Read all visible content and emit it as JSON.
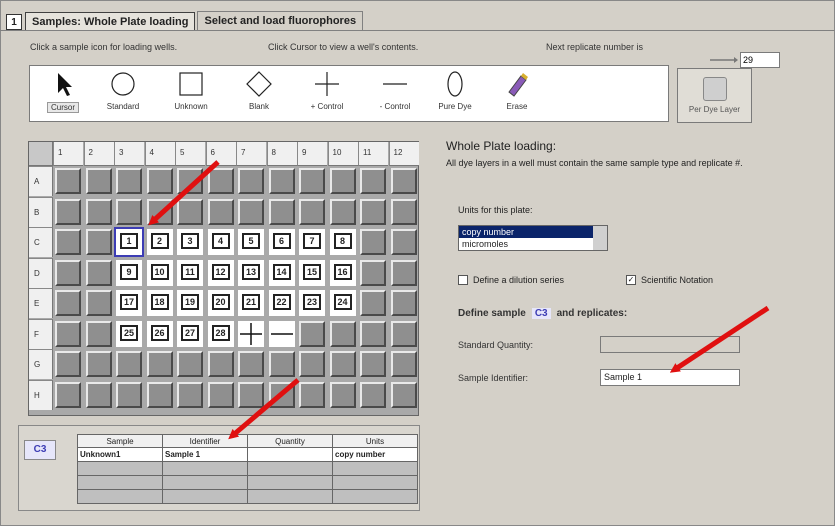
{
  "tabs": {
    "number": "1",
    "items": [
      {
        "label": "Samples: Whole Plate loading",
        "active": true
      },
      {
        "label": "Select and load fluorophores",
        "active": false
      }
    ]
  },
  "hints": {
    "left": "Click a sample icon for loading wells.",
    "mid": "Click Cursor to view a well's contents.",
    "replicate_label": "Next replicate number is",
    "replicate_value": "29"
  },
  "tools": [
    {
      "label": "Cursor",
      "icon": "cursor-icon"
    },
    {
      "label": "Standard",
      "icon": "circle-icon"
    },
    {
      "label": "Unknown",
      "icon": "square-icon"
    },
    {
      "label": "Blank",
      "icon": "diamond-icon"
    },
    {
      "label": "+ Control",
      "icon": "plus-icon"
    },
    {
      "label": "- Control",
      "icon": "minus-icon"
    },
    {
      "label": "Pure Dye",
      "icon": "oval-icon"
    },
    {
      "label": "Erase",
      "icon": "eraser-icon"
    }
  ],
  "per_dye_layer": {
    "label": "Per Dye Layer"
  },
  "plate": {
    "columns": [
      "1",
      "2",
      "3",
      "4",
      "5",
      "6",
      "7",
      "8",
      "9",
      "10",
      "11",
      "12"
    ],
    "rows": [
      "A",
      "B",
      "C",
      "D",
      "E",
      "F",
      "G",
      "H"
    ],
    "filled": [
      {
        "row": "C",
        "col": 3,
        "num": "1",
        "selected": true
      },
      {
        "row": "C",
        "col": 4,
        "num": "2"
      },
      {
        "row": "C",
        "col": 5,
        "num": "3"
      },
      {
        "row": "C",
        "col": 6,
        "num": "4"
      },
      {
        "row": "C",
        "col": 7,
        "num": "5"
      },
      {
        "row": "C",
        "col": 8,
        "num": "6"
      },
      {
        "row": "C",
        "col": 9,
        "num": "7"
      },
      {
        "row": "C",
        "col": 10,
        "num": "8"
      },
      {
        "row": "D",
        "col": 3,
        "num": "9"
      },
      {
        "row": "D",
        "col": 4,
        "num": "10"
      },
      {
        "row": "D",
        "col": 5,
        "num": "11"
      },
      {
        "row": "D",
        "col": 6,
        "num": "12"
      },
      {
        "row": "D",
        "col": 7,
        "num": "13"
      },
      {
        "row": "D",
        "col": 8,
        "num": "14"
      },
      {
        "row": "D",
        "col": 9,
        "num": "15"
      },
      {
        "row": "D",
        "col": 10,
        "num": "16"
      },
      {
        "row": "E",
        "col": 3,
        "num": "17"
      },
      {
        "row": "E",
        "col": 4,
        "num": "18"
      },
      {
        "row": "E",
        "col": 5,
        "num": "19"
      },
      {
        "row": "E",
        "col": 6,
        "num": "20"
      },
      {
        "row": "E",
        "col": 7,
        "num": "21"
      },
      {
        "row": "E",
        "col": 8,
        "num": "22"
      },
      {
        "row": "E",
        "col": 9,
        "num": "23"
      },
      {
        "row": "E",
        "col": 10,
        "num": "24"
      },
      {
        "row": "F",
        "col": 3,
        "num": "25"
      },
      {
        "row": "F",
        "col": 4,
        "num": "26"
      },
      {
        "row": "F",
        "col": 5,
        "num": "27"
      },
      {
        "row": "F",
        "col": 6,
        "num": "28"
      },
      {
        "row": "F",
        "col": 7,
        "symbol": "plus"
      },
      {
        "row": "F",
        "col": 8,
        "symbol": "minus"
      }
    ]
  },
  "right": {
    "title": "Whole Plate loading:",
    "desc": "All dye layers in a well must contain the same sample type and replicate #.",
    "units_label": "Units for this plate:",
    "units_options": [
      "copy number",
      "micromoles"
    ],
    "units_selected": "copy number",
    "dilution_label": "Define a dilution series",
    "dilution_checked": false,
    "scinot_label": "Scientific Notation",
    "scinot_checked": true,
    "define_prefix": "Define sample",
    "define_well": "C3",
    "define_suffix": "and replicates:",
    "std_qty_label": "Standard Quantity:",
    "std_qty_value": "",
    "sample_id_label": "Sample Identifier:",
    "sample_id_value": "Sample 1"
  },
  "summary": {
    "well": "C3",
    "headers": [
      "Sample",
      "Identifier",
      "Quantity",
      "Units"
    ],
    "rows": [
      [
        "Unknown1",
        "Sample 1",
        "",
        "copy number"
      ],
      [
        "",
        "",
        "",
        ""
      ],
      [
        "",
        "",
        "",
        ""
      ],
      [
        "",
        "",
        "",
        ""
      ]
    ]
  },
  "colors": {
    "arrow": "#e01010",
    "selection": "#3c3cb4",
    "list_highlight": "#0a246a"
  }
}
